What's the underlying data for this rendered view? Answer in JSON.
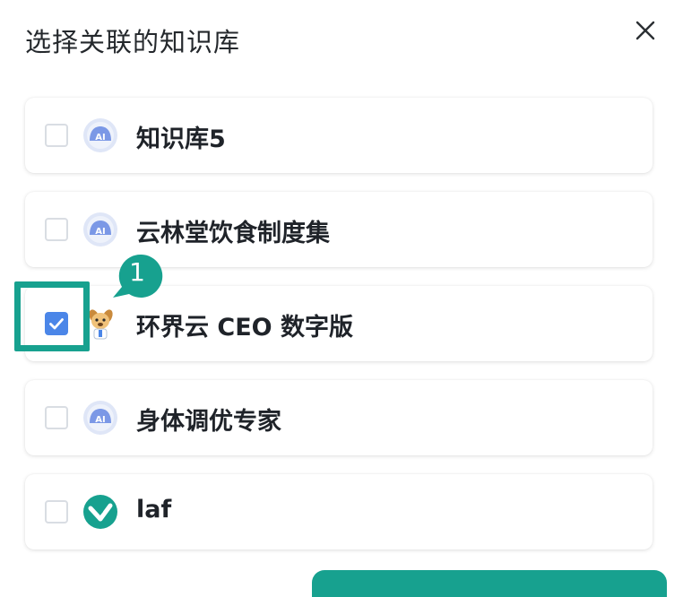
{
  "dialog": {
    "title": "选择关联的知识库"
  },
  "items": [
    {
      "label": "知识库5",
      "checked": false,
      "icon": "ai-avatar-icon"
    },
    {
      "label": "云林堂饮食制度集",
      "checked": false,
      "icon": "ai-avatar-icon"
    },
    {
      "label": "环界云 CEO 数字版",
      "checked": true,
      "icon": "dog-mascot-icon"
    },
    {
      "label": "身体调优专家",
      "checked": false,
      "icon": "ai-avatar-icon"
    },
    {
      "label": "laf",
      "checked": false,
      "icon": "laf-logo-icon"
    }
  ],
  "annotation": {
    "step_number": "1"
  },
  "colors": {
    "accent": "#17a18f",
    "checkbox_checked": "#4b86e8",
    "avatar_blue": "#6f8fe0"
  }
}
